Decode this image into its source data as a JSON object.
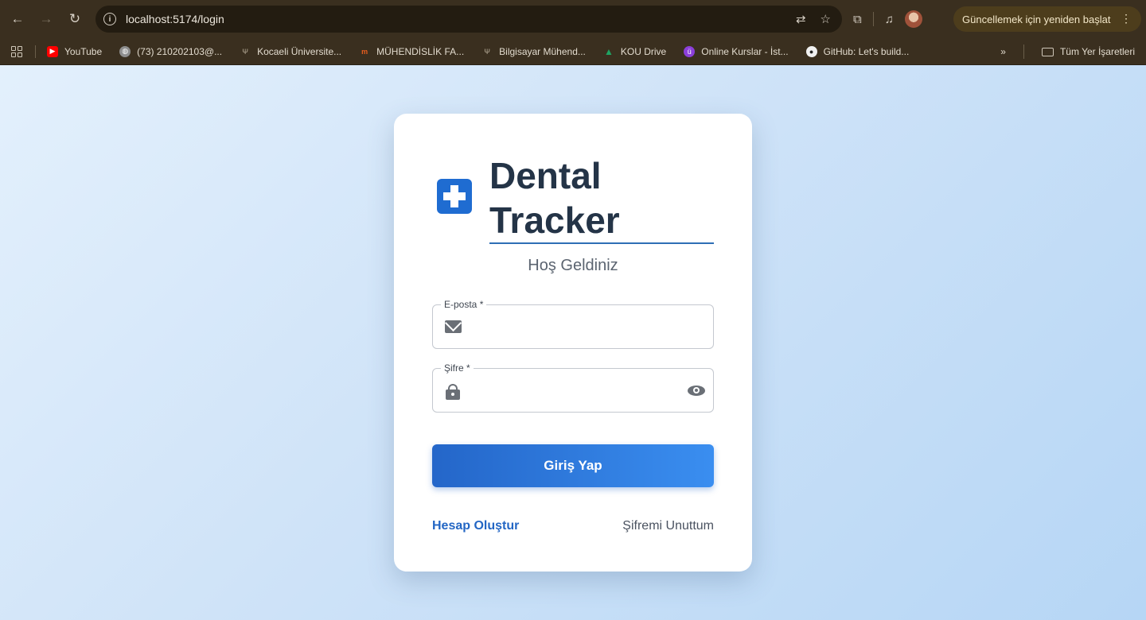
{
  "browser": {
    "url": "localhost:5174/login",
    "update_button": "Güncellemek için yeniden başlat",
    "bookmarks": [
      {
        "label": "YouTube",
        "color": "#ff0000"
      },
      {
        "label": "(73) 210202103@...",
        "color": "#8e8e8e"
      },
      {
        "label": "Kocaeli Üniversite...",
        "color": "#8a7f6d"
      },
      {
        "label": "MÜHENDİSLİK FA...",
        "color": "#e85d1f"
      },
      {
        "label": "Bilgisayar Mühend...",
        "color": "#8a7f6d"
      },
      {
        "label": "KOU Drive",
        "color": "#1fa463"
      },
      {
        "label": "Online Kurslar - İst...",
        "color": "#8b3fd9"
      },
      {
        "label": "GitHub: Let's build...",
        "color": "#f0f0f0"
      }
    ],
    "bookmarks_overflow": "»",
    "all_bookmarks": "Tüm Yer İşaretleri"
  },
  "login": {
    "title_line1": "Dental",
    "title_line2": "Tracker",
    "subtitle": "Hoş Geldiniz",
    "email_label": "E-posta *",
    "email_value": "",
    "password_label": "Şifre *",
    "password_value": "",
    "submit_label": "Giriş Yap",
    "create_account": "Hesap Oluştur",
    "forgot_password": "Şifremi Unuttum",
    "accent_color": "#2466c9"
  }
}
